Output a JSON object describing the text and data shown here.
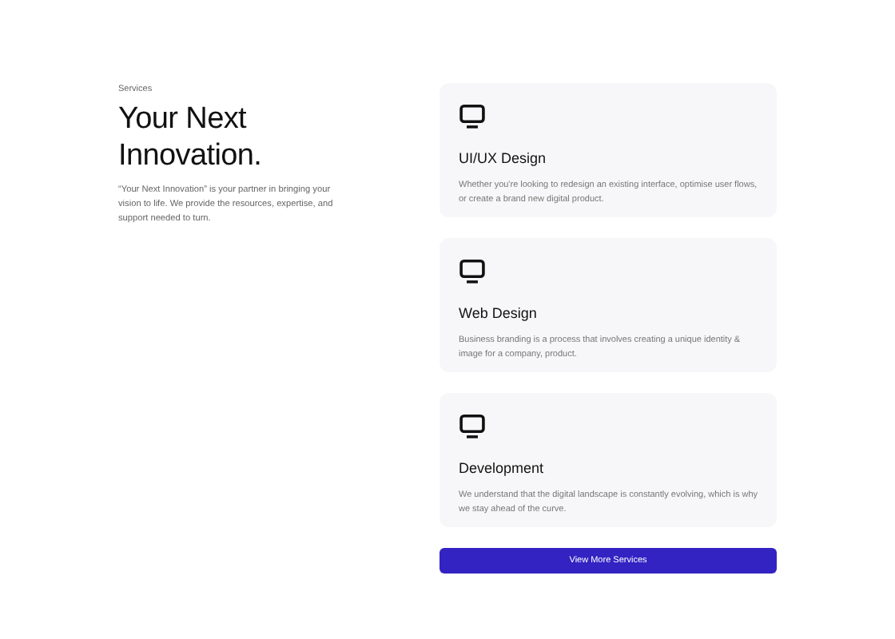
{
  "eyebrow": "Services",
  "heading": "Your Next Innovation.",
  "intro": "“Your Next Innovation” is your partner in bringing your vision to life. We provide the resources, expertise, and support needed to turn.",
  "services": [
    {
      "title": "UI/UX Design",
      "description": "Whether you're looking to redesign an existing interface, optimise user flows, or create a brand new digital product."
    },
    {
      "title": "Web Design",
      "description": "Business branding is a process that involves creating a unique identity & image for a company, product."
    },
    {
      "title": "Development",
      "description": "We understand that the digital landscape is constantly evolving, which is why we stay ahead of the curve."
    }
  ],
  "button": "View More Services"
}
